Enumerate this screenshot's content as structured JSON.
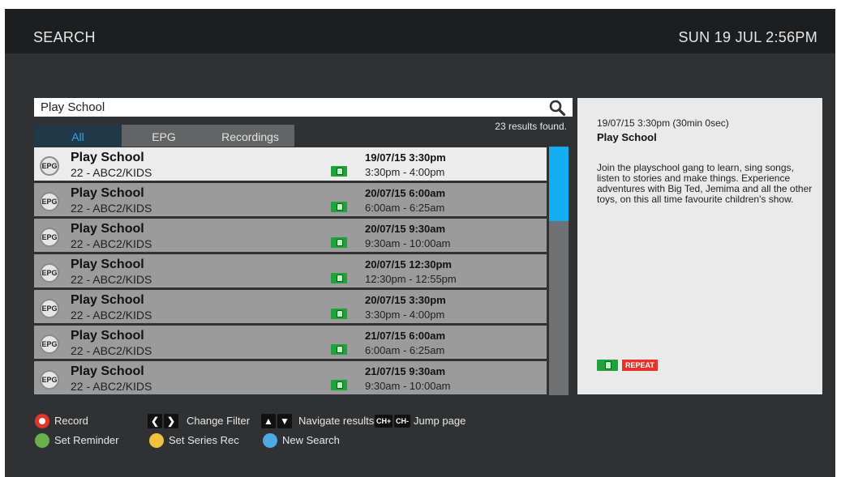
{
  "header": {
    "title": "SEARCH",
    "clock": "SUN 19 JUL 2:56PM"
  },
  "search": {
    "query": "Play School",
    "icon": "search-icon"
  },
  "results_count": "23 results found.",
  "tabs": [
    {
      "label": "All",
      "active": true
    },
    {
      "label": "EPG",
      "active": false
    },
    {
      "label": "Recordings",
      "active": false
    }
  ],
  "results": [
    {
      "source": "EPG",
      "name": "Play School",
      "channel": "22 - ABC2/KIDS",
      "date": "19/07/15 3:30pm",
      "time": "3:30pm - 4:00pm",
      "selected": true
    },
    {
      "source": "EPG",
      "name": "Play School",
      "channel": "22 - ABC2/KIDS",
      "date": "20/07/15 6:00am",
      "time": "6:00am - 6:25am"
    },
    {
      "source": "EPG",
      "name": "Play School",
      "channel": "22 - ABC2/KIDS",
      "date": "20/07/15 9:30am",
      "time": "9:30am - 10:00am"
    },
    {
      "source": "EPG",
      "name": "Play School",
      "channel": "22 - ABC2/KIDS",
      "date": "20/07/15 12:30pm",
      "time": "12:30pm - 12:55pm"
    },
    {
      "source": "EPG",
      "name": "Play School",
      "channel": "22 - ABC2/KIDS",
      "date": "20/07/15 3:30pm",
      "time": "3:30pm - 4:00pm"
    },
    {
      "source": "EPG",
      "name": "Play School",
      "channel": "22 - ABC2/KIDS",
      "date": "21/07/15 6:00am",
      "time": "6:00am - 6:25am"
    },
    {
      "source": "EPG",
      "name": "Play School",
      "channel": "22 - ABC2/KIDS",
      "date": "21/07/15 9:30am",
      "time": "9:30am - 10:00am"
    }
  ],
  "detail": {
    "timestamp": "19/07/15 3:30pm (30min 0sec)",
    "title": "Play School",
    "description": "Join the playschool gang to learn, sing songs, listen to stories and make things. Experience adventures with Big Ted, Jemima and all the other toys, on this all time favourite children's show.",
    "repeat_label": "REPEAT"
  },
  "legend": {
    "record": "Record",
    "change_filter": "Change Filter",
    "navigate": "Navigate results",
    "ch_plus": "CH+",
    "ch_minus": "CH-",
    "jump": "Jump page",
    "reminder": "Set Reminder",
    "series": "Set Series Rec",
    "new_search": "New Search"
  },
  "colors": {
    "accent": "#11aef2",
    "red": "#e5332a",
    "green": "#6ab04c",
    "yellow": "#f0c23b",
    "blue": "#4fa9e4",
    "badge_green": "#1fa23a"
  }
}
